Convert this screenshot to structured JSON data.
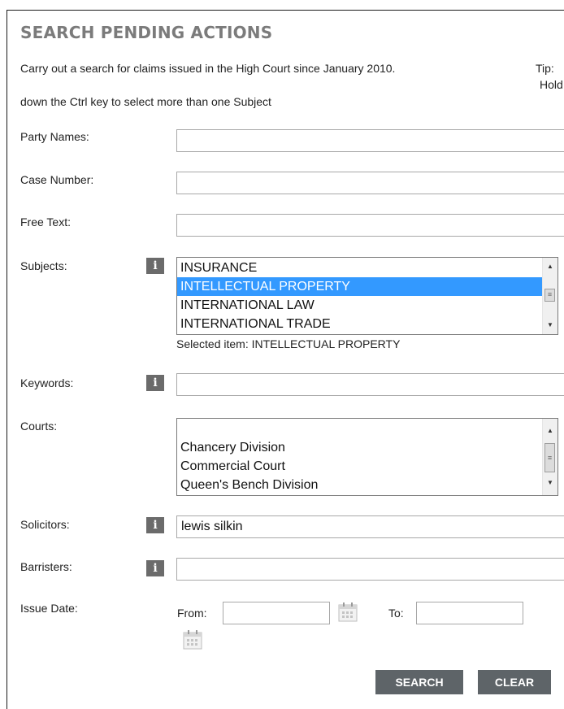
{
  "title": "SEARCH PENDING ACTIONS",
  "intro": {
    "line1": "Carry out a search for claims issued in the High Court since January 2010.",
    "tip": "Tip:",
    "hold": "Hold",
    "line2": "down the Ctrl key to select more than one Subject"
  },
  "fields": {
    "party_names": {
      "label": "Party Names:",
      "value": ""
    },
    "case_number": {
      "label": "Case Number:",
      "value": ""
    },
    "free_text": {
      "label": "Free Text:",
      "value": ""
    },
    "keywords": {
      "label": "Keywords:",
      "value": ""
    },
    "solicitors": {
      "label": "Solicitors:",
      "value": "lewis silkin"
    },
    "barristers": {
      "label": "Barristers:",
      "value": ""
    }
  },
  "subjects": {
    "label": "Subjects:",
    "options": [
      "INSURANCE",
      "INTELLECTUAL PROPERTY",
      "INTERNATIONAL LAW",
      "INTERNATIONAL TRADE"
    ],
    "selected": "INTELLECTUAL PROPERTY",
    "selected_text": "Selected item: INTELLECTUAL PROPERTY"
  },
  "courts": {
    "label": "Courts:",
    "options": [
      "",
      "Chancery Division",
      "Commercial Court",
      "Queen's Bench Division"
    ]
  },
  "issue_date": {
    "label": "Issue Date:",
    "from_label": "From:",
    "to_label": "To:",
    "from_value": "",
    "to_value": ""
  },
  "info_icon_glyph": "i",
  "buttons": {
    "search": "SEARCH",
    "clear": "CLEAR"
  },
  "colors": {
    "title": "#7b7b7b",
    "selection": "#3399ff",
    "button_bg": "#5e6468",
    "info_bg": "#6b6b6b"
  }
}
